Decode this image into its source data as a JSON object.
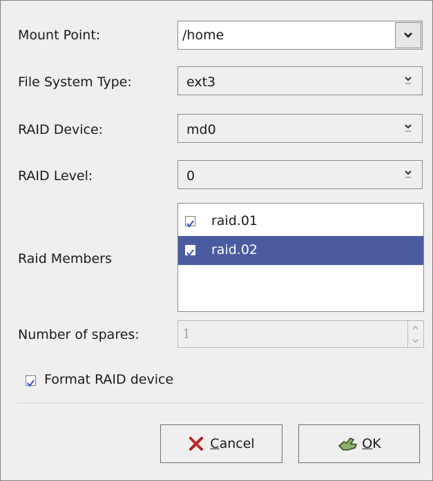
{
  "form": {
    "mount_point": {
      "label": "Mount Point:",
      "value": "/home"
    },
    "fs_type": {
      "label": "File System Type:",
      "value": "ext3"
    },
    "raid_device": {
      "label": "RAID Device:",
      "value": "md0"
    },
    "raid_level": {
      "label": "RAID Level:",
      "value": "0"
    },
    "raid_members": {
      "label": "Raid Members",
      "items": [
        {
          "label": "raid.01",
          "checked": true,
          "selected": false
        },
        {
          "label": "raid.02",
          "checked": true,
          "selected": true
        }
      ]
    },
    "spares": {
      "label": "Number of spares:",
      "value": "1"
    },
    "format": {
      "label": "Format RAID device",
      "checked": true
    }
  },
  "buttons": {
    "cancel": {
      "mnemonic": "C",
      "rest": "ancel",
      "icon": "cancel-x-icon"
    },
    "ok": {
      "mnemonic": "O",
      "rest": "K",
      "icon": "ok-hand-icon"
    }
  },
  "colors": {
    "selection": "#4b5ba0",
    "check": "#3a57c4",
    "cancel_icon": "#b31b1b",
    "ok_icon": "#6b8e52"
  }
}
